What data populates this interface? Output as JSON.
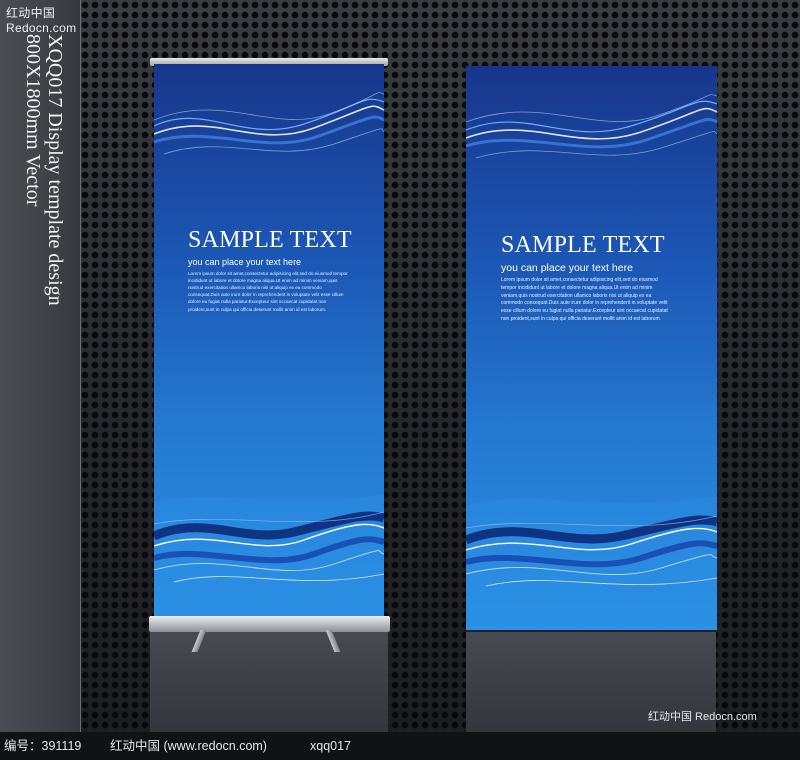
{
  "watermark_top": "红动中国 Redocn.com",
  "vertical_title": {
    "line1": "XQQ017 Display template design",
    "line2": "800X1800mm Vector"
  },
  "banners": {
    "left": {
      "title": "SAMPLE TEXT",
      "subtitle": "you can place your text here",
      "body": "Lorem ipsum dolor sit amet,consectetur adipisicing elit,sed do eiusmod tempor incididunt ut labore et dolore magna aliqua.Ut enim ad minim veniam,quis nostrud exercitation ullamco laboris nisi ut aliquip ex ea commodo consequat.Duis aute irure dolor in reprehenderit in voluptate velit esse cillum dolore eu fugiat nulla pariatur.Excepteur sint occaecat cupidatat non proident,sunt in culpa qui officia deserunt mollit anim id est laborum."
    },
    "right": {
      "title": "SAMPLE TEXT",
      "subtitle": "you can place your text here",
      "body": "Lorem ipsum dolor sit amet,consectetur adipisicing elit,sed do eiusmod tempor incididunt ut labore et dolore magna aliqua.Ut enim ad minim veniam,quis nostrud exercitation ullamco laboris nisi ut aliquip ex ea commodo consequat.Duis aute irure dolor in reprehenderit in voluptate velit esse cillum dolore eu fugiat nulla pariatur.Excepteur sint occaecat cupidatat non proident,sunt in culpa qui officia deserunt mollit anim id est laborum."
    }
  },
  "watermark_bottom": "红动中国 Redocn.com",
  "info_bar": {
    "id_label": "编号：391119",
    "site": "红动中国 (www.redocn.com)",
    "code": "xqq017"
  },
  "colors": {
    "banner_dark": "#17368a",
    "banner_light": "#2c92e4",
    "background": "#2a2d31"
  }
}
